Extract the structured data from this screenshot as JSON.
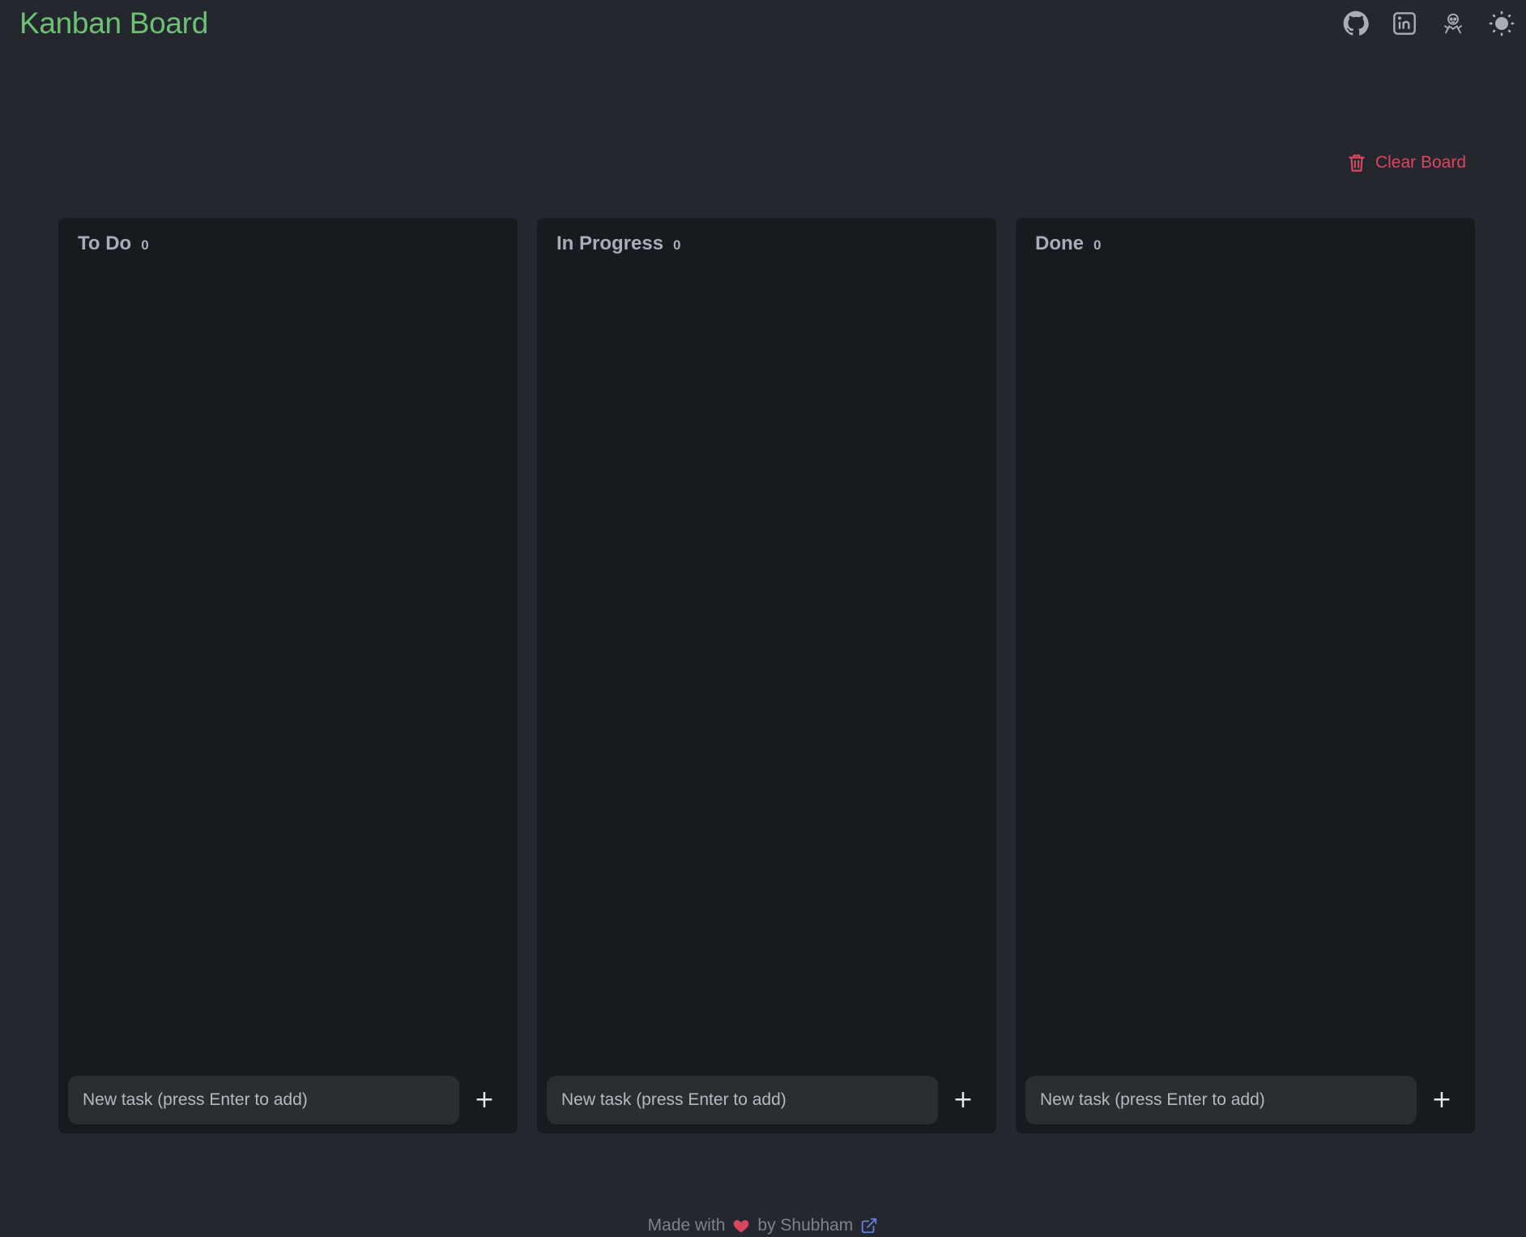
{
  "header": {
    "title": "Kanban Board",
    "icons": [
      "github-icon",
      "linkedin-icon",
      "portfolio-icon",
      "theme-toggle-icon"
    ]
  },
  "toolbar": {
    "clear_label": "Clear Board"
  },
  "columns": [
    {
      "title": "To Do",
      "count": "0",
      "placeholder": "New task (press Enter to add)",
      "add_label": "+"
    },
    {
      "title": "In Progress",
      "count": "0",
      "placeholder": "New task (press Enter to add)",
      "add_label": "+"
    },
    {
      "title": "Done",
      "count": "0",
      "placeholder": "New task (press Enter to add)",
      "add_label": "+"
    }
  ],
  "footer": {
    "made_with": "Made with",
    "by": "by Shubham"
  },
  "colors": {
    "background": "#24272d",
    "column": "#171a1e",
    "title": "#6cc173",
    "danger": "#d9465f",
    "link": "#6b7fd7"
  }
}
